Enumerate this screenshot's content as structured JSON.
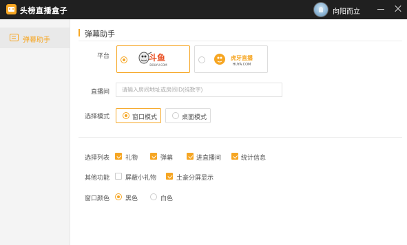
{
  "titlebar": {
    "app_title": "头榜直播盒子",
    "username": "向阳而立"
  },
  "sidebar": {
    "items": [
      {
        "label": "弹幕助手",
        "icon": "chat-bubble-icon"
      }
    ]
  },
  "main": {
    "section_title": "弹幕助手",
    "platform": {
      "label": "平台",
      "options": [
        {
          "name": "斗鱼",
          "sub": "DOUYU.COM",
          "selected": true
        },
        {
          "name": "虎牙直播",
          "sub": "HUYA.COM",
          "selected": false
        }
      ]
    },
    "room": {
      "label": "直播间",
      "value": "",
      "placeholder": "请输入房间地址或房间ID(纯数字)"
    },
    "mode": {
      "label": "选择模式",
      "options": [
        {
          "label": "窗口模式",
          "selected": true
        },
        {
          "label": "桌面模式",
          "selected": false
        }
      ]
    },
    "list": {
      "label": "选择列表",
      "options": [
        {
          "label": "礼物",
          "checked": true
        },
        {
          "label": "弹幕",
          "checked": true
        },
        {
          "label": "进直播间",
          "checked": true
        },
        {
          "label": "统计信息",
          "checked": true
        }
      ]
    },
    "other": {
      "label": "其他功能",
      "options": [
        {
          "label": "屏蔽小礼物",
          "checked": false
        },
        {
          "label": "土豪分屏显示",
          "checked": true
        }
      ]
    },
    "color": {
      "label": "窗口颜色",
      "options": [
        {
          "label": "黑色",
          "selected": true
        },
        {
          "label": "白色",
          "selected": false
        }
      ]
    }
  },
  "colors": {
    "accent": "#f6a623",
    "titlebar": "#202020",
    "sidebar_bg": "#f4f4f4"
  }
}
